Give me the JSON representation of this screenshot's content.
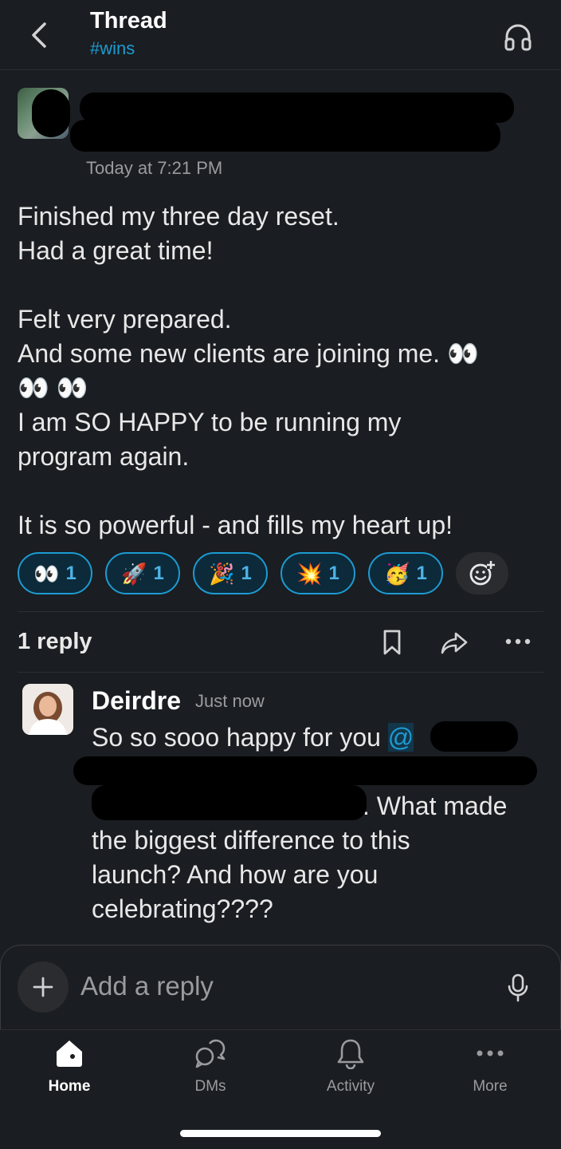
{
  "header": {
    "title": "Thread",
    "channel": "#wins"
  },
  "message": {
    "timestamp": "Today at 7:21 PM",
    "lines": [
      "Finished my three day reset.",
      "Had a great time!",
      "",
      "Felt very prepared.",
      "And some new clients are joining me. 👀",
      "👀 👀",
      "I am SO HAPPY to be running my",
      "program again.",
      "",
      "It is so powerful - and fills my heart up!"
    ],
    "reactions": [
      {
        "emoji": "👀",
        "count": "1"
      },
      {
        "emoji": "🚀",
        "count": "1"
      },
      {
        "emoji": "🎉",
        "count": "1"
      },
      {
        "emoji": "💥",
        "count": "1"
      },
      {
        "emoji": "🥳",
        "count": "1"
      }
    ]
  },
  "thread": {
    "reply_count": "1 reply"
  },
  "reply": {
    "author": "Deirdre",
    "time": "Just now",
    "line1_text": "So so sooo happy for you ",
    "mention_start": "@",
    "line3_tail": ". What made",
    "line4": "the biggest difference to this",
    "line5": "launch? And how are you",
    "line6": "celebrating????"
  },
  "composer": {
    "placeholder": "Add a reply"
  },
  "tabs": [
    {
      "label": "Home",
      "icon": "home-icon",
      "active": true
    },
    {
      "label": "DMs",
      "icon": "dms-icon",
      "active": false
    },
    {
      "label": "Activity",
      "icon": "bell-icon",
      "active": false
    },
    {
      "label": "More",
      "icon": "more-icon",
      "active": false
    }
  ],
  "colors": {
    "background": "#1a1d21",
    "accent": "#1d9bd1",
    "text": "#e8e8e8",
    "muted": "#9a9b9e"
  }
}
